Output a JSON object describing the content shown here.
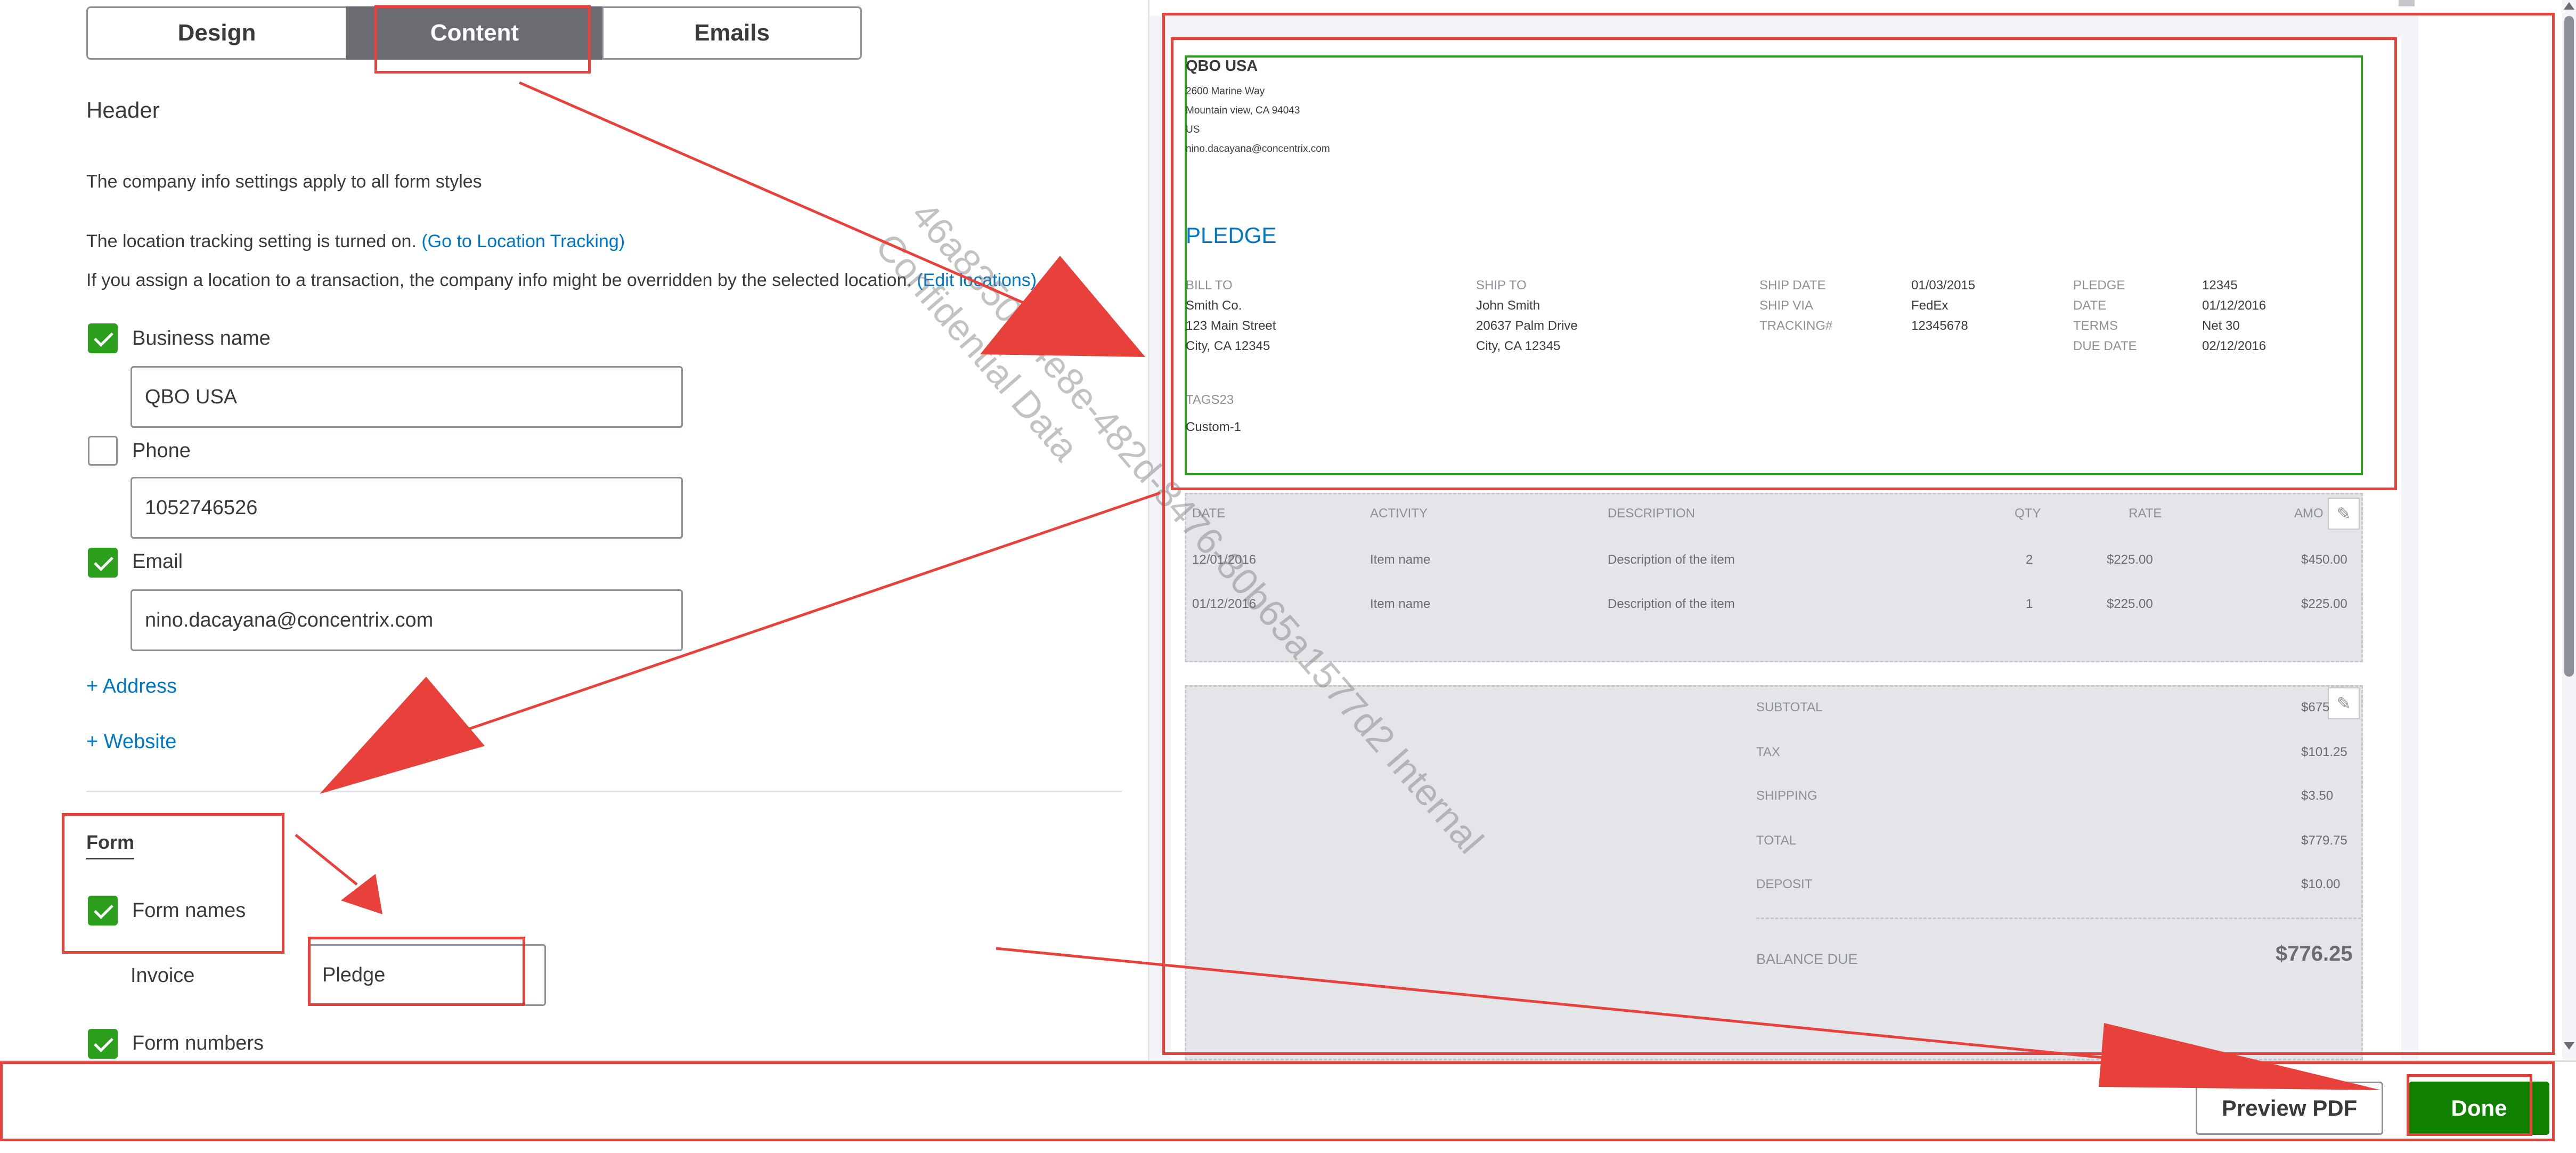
{
  "tabs": [
    {
      "label": "Design"
    },
    {
      "label": "Content"
    },
    {
      "label": "Emails"
    }
  ],
  "header": {
    "title": "Header",
    "company_info_note": "The company info settings apply to all form styles",
    "location_note": "The location tracking setting is turned on.",
    "location_link": "(Go to Location Tracking)",
    "assign_note": "If you assign a location to a transaction, the company info might be overridden by the selected location.",
    "edit_locations_link": "(Edit locations)",
    "fields": [
      {
        "label": "Business name",
        "checked": true,
        "value": "QBO USA"
      },
      {
        "label": "Phone",
        "checked": false,
        "value": "1052746526"
      },
      {
        "label": "Email",
        "checked": true,
        "value": "nino.dacayana@concentrix.com"
      }
    ],
    "add_address": "+ Address",
    "add_website": "+ Website"
  },
  "form": {
    "title": "Form",
    "form_names_label": "Form names",
    "invoice_label": "Invoice",
    "invoice_value": "Pledge",
    "form_numbers_label": "Form numbers"
  },
  "preview": {
    "company": "QBO USA",
    "address_lines": [
      "2600 Marine Way",
      "Mountain view, CA 94043",
      "US",
      "nino.dacayana@concentrix.com"
    ],
    "doc_title": "PLEDGE",
    "bill_to_label": "BILL TO",
    "bill_to": [
      "Smith Co.",
      "123 Main Street",
      "City, CA 12345"
    ],
    "ship_to_label": "SHIP TO",
    "ship_to": [
      "John Smith",
      "20637 Palm Drive",
      "City, CA 12345"
    ],
    "meta1": [
      {
        "label": "SHIP DATE",
        "value": "01/03/2015"
      },
      {
        "label": "SHIP VIA",
        "value": "FedEx"
      },
      {
        "label": "TRACKING#",
        "value": "12345678"
      }
    ],
    "meta2": [
      {
        "label": "PLEDGE",
        "value": "12345"
      },
      {
        "label": "DATE",
        "value": "01/12/2016"
      },
      {
        "label": "TERMS",
        "value": "Net 30"
      },
      {
        "label": "DUE DATE",
        "value": "02/12/2016"
      }
    ],
    "tags_label": "TAGS23",
    "tags_value": "Custom-1",
    "columns": {
      "date": "DATE",
      "activity": "ACTIVITY",
      "description": "DESCRIPTION",
      "qty": "QTY",
      "rate": "RATE",
      "amount": "AMO"
    },
    "rows": [
      {
        "date": "12/01/2016",
        "activity": "Item name",
        "description": "Description of the item",
        "qty": "2",
        "rate": "$225.00",
        "amount": "$450.00"
      },
      {
        "date": "01/12/2016",
        "activity": "Item name",
        "description": "Description of the item",
        "qty": "1",
        "rate": "$225.00",
        "amount": "$225.00"
      }
    ],
    "totals": [
      {
        "label": "SUBTOTAL",
        "value": "$675"
      },
      {
        "label": "TAX",
        "value": "$101.25"
      },
      {
        "label": "SHIPPING",
        "value": "$3.50"
      },
      {
        "label": "TOTAL",
        "value": "$779.75"
      },
      {
        "label": "DEPOSIT",
        "value": "$10.00"
      }
    ],
    "balance_label": "BALANCE DUE",
    "balance_value": "$776.25",
    "watermark": "46a83500-4e8e-482d-8476-80b65a1577d2 Internal Confidential Data"
  },
  "footer": {
    "preview_pdf": "Preview PDF",
    "done": "Done"
  },
  "colors": {
    "accent_green": "#2ca01c",
    "done_green": "#108000",
    "link_blue": "#0077c5",
    "preview_blue": "#0077c5",
    "annotation_red": "#e8413b"
  }
}
